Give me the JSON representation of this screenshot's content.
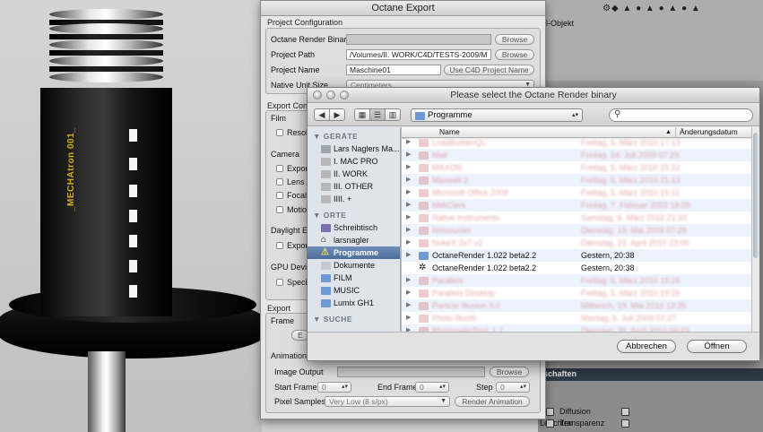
{
  "viewport": {
    "product_label": "_MECHAtron 001_"
  },
  "c4d": {
    "object_label": "il-Objekt",
    "icons_text": "⚙◆ ▲ ● ▲ ● ▲ ● ▲",
    "attr_header": "schaften",
    "rows": [
      {
        "label": "Diffusion"
      },
      {
        "label": "Leuchten"
      },
      {
        "label": "Transparenz"
      }
    ]
  },
  "export": {
    "title": "Octane Export",
    "project_config": {
      "title": "Project Configuration",
      "render_binary_label": "Octane Render Binary",
      "render_binary_value": "",
      "project_path_label": "Project Path",
      "project_path_value": "/Volumes/II. WORK/C4D/TESTS-2009/M",
      "project_name_label": "Project Name",
      "project_name_value": "Maschine01",
      "native_unit_label": "Native Unit Size",
      "native_unit_value": "Centimeters",
      "browse": "Browse",
      "use_c4d_name": "Use C4D Project Name"
    },
    "export_config": {
      "title": "Export Conf",
      "film_title": "Film",
      "resolution_label": "Resol",
      "camera_title": "Camera",
      "cam_items": [
        "Export",
        "Lens A",
        "Focal D",
        "Motion"
      ],
      "daylight_title": "Daylight Er",
      "daylight_items": [
        "Export"
      ],
      "gpu_title": "GPU Device",
      "gpu_items": [
        "Specify"
      ]
    },
    "export_group": {
      "title": "Export",
      "frame_title": "Frame",
      "frame_button": "E",
      "animation_title": "Animation",
      "image_output_label": "Image Output",
      "browse": "Browse",
      "start_frame_label": "Start Frame",
      "start_frame_value": "0",
      "end_frame_label": "End Frame",
      "end_frame_value": "0",
      "step_label": "Step",
      "step_value": "0",
      "pixel_samples_label": "Pixel Samples",
      "pixel_samples_value": "Very Low (8 s/px)",
      "render_animation": "Render Animation"
    }
  },
  "dialog": {
    "title": "Please select the Octane Render binary",
    "path_popup": "Programme",
    "search_placeholder": "",
    "sidebar": {
      "devices_header": "GERÄTE",
      "devices": [
        "Lars Naglers Ma...",
        "I. MAC PRO",
        "II. WORK",
        "III. OTHER",
        "IIII. +"
      ],
      "places_header": "ORTE",
      "places": [
        "Schreibtisch",
        "larsnagler",
        "Programme",
        "Dokumente",
        "FILM",
        "MUSIC",
        "Lumix GH1"
      ],
      "search_header": "SUCHE",
      "selected_place": "Programme"
    },
    "columns": {
      "name": "Name",
      "date": "Änderungsdatum"
    },
    "files": [
      {
        "name": "LoadBuilderQL",
        "date": "Freitag, 5. März 2010 17:13",
        "state": "blur"
      },
      {
        "name": "Mail",
        "date": "Freitag, 24. Juli 2009 07:29",
        "state": "blur"
      },
      {
        "name": "MAXON",
        "date": "Freitag, 5. März 2010 15:22",
        "state": "blur"
      },
      {
        "name": "Maxwell 2",
        "date": "Freitag, 5. März 2010 21:13",
        "state": "blur"
      },
      {
        "name": "Microsoft Office 2008",
        "date": "Freitag, 5. März 2010 15:11",
        "state": "blur"
      },
      {
        "name": "MidiClerk",
        "date": "Freitag, 7. Februar 2003 18:09",
        "state": "blur"
      },
      {
        "name": "Native Instruments",
        "date": "Samstag, 6. März 2010 21:33",
        "state": "blur"
      },
      {
        "name": "Noiseunter",
        "date": "Dienstag, 19. Mai 2009 07:28",
        "state": "blur"
      },
      {
        "name": "NukeX 2x7 v2",
        "date": "Dienstag, 23. April 2010 23:06",
        "state": "blur"
      },
      {
        "name": "OctaneRender 1.022 beta2.2",
        "date": "Gestern, 20:38",
        "state": "sharp",
        "kind": "folder"
      },
      {
        "name": "OctaneRender 1.022 beta2.2",
        "date": "Gestern, 20:38",
        "state": "sharp",
        "kind": "app"
      },
      {
        "name": "Parallels",
        "date": "Freitag, 5. März 2010 19:26",
        "state": "blur"
      },
      {
        "name": "Parallels Desktop",
        "date": "Freitag, 5. März 2010 19:26",
        "state": "blur"
      },
      {
        "name": "Particle Illusion 3.0",
        "date": "Mittwoch, 19. Mai 2010 13:35",
        "state": "blur"
      },
      {
        "name": "Photo Booth",
        "date": "Montag, 6. Juli 2009 07:27",
        "state": "blur"
      },
      {
        "name": "PhotomaticPro1.1.7",
        "date": "Dienstag, 20. April 2010 09:43",
        "state": "blur"
      }
    ],
    "cancel": "Abbrechen",
    "open": "Öffnen"
  }
}
